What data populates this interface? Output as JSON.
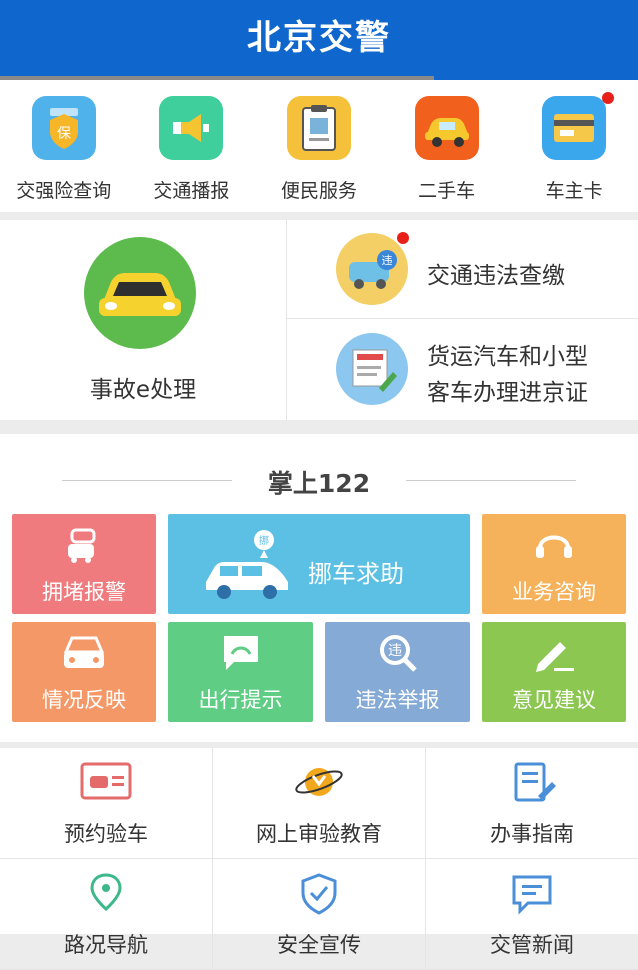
{
  "header": {
    "title": "北京交警"
  },
  "top_items": [
    {
      "label": "交强险查询",
      "icon": "insurance-shield-icon"
    },
    {
      "label": "交通播报",
      "icon": "megaphone-icon"
    },
    {
      "label": "便民服务",
      "icon": "clipboard-id-icon"
    },
    {
      "label": "二手车",
      "icon": "car-icon"
    },
    {
      "label": "车主卡",
      "icon": "credit-card-icon"
    }
  ],
  "mid": {
    "accident": "事故e处理",
    "violation": "交通违法查缴",
    "permit_line1": "货运汽车和小型",
    "permit_line2": "客车办理进京证"
  },
  "section": {
    "title": "掌上122"
  },
  "tiles": [
    {
      "label": "拥堵报警",
      "color": "#ef7b7e"
    },
    {
      "label": "挪车求助",
      "color": "#5cc0e4"
    },
    {
      "label": "业务咨询",
      "color": "#f6b25b"
    },
    {
      "label": "情况反映",
      "color": "#f59868"
    },
    {
      "label": "出行提示",
      "color": "#5fce84"
    },
    {
      "label": "违法举报",
      "color": "#85aad6"
    },
    {
      "label": "意见建议",
      "color": "#8bc751"
    }
  ],
  "bottom": [
    {
      "label": "预约验车"
    },
    {
      "label": "网上审验教育"
    },
    {
      "label": "办事指南"
    },
    {
      "label": "路况导航"
    },
    {
      "label": "安全宣传"
    },
    {
      "label": "交管新闻"
    }
  ],
  "colors": {
    "header": "#0f66cc",
    "accent_red": "#e8201a"
  }
}
